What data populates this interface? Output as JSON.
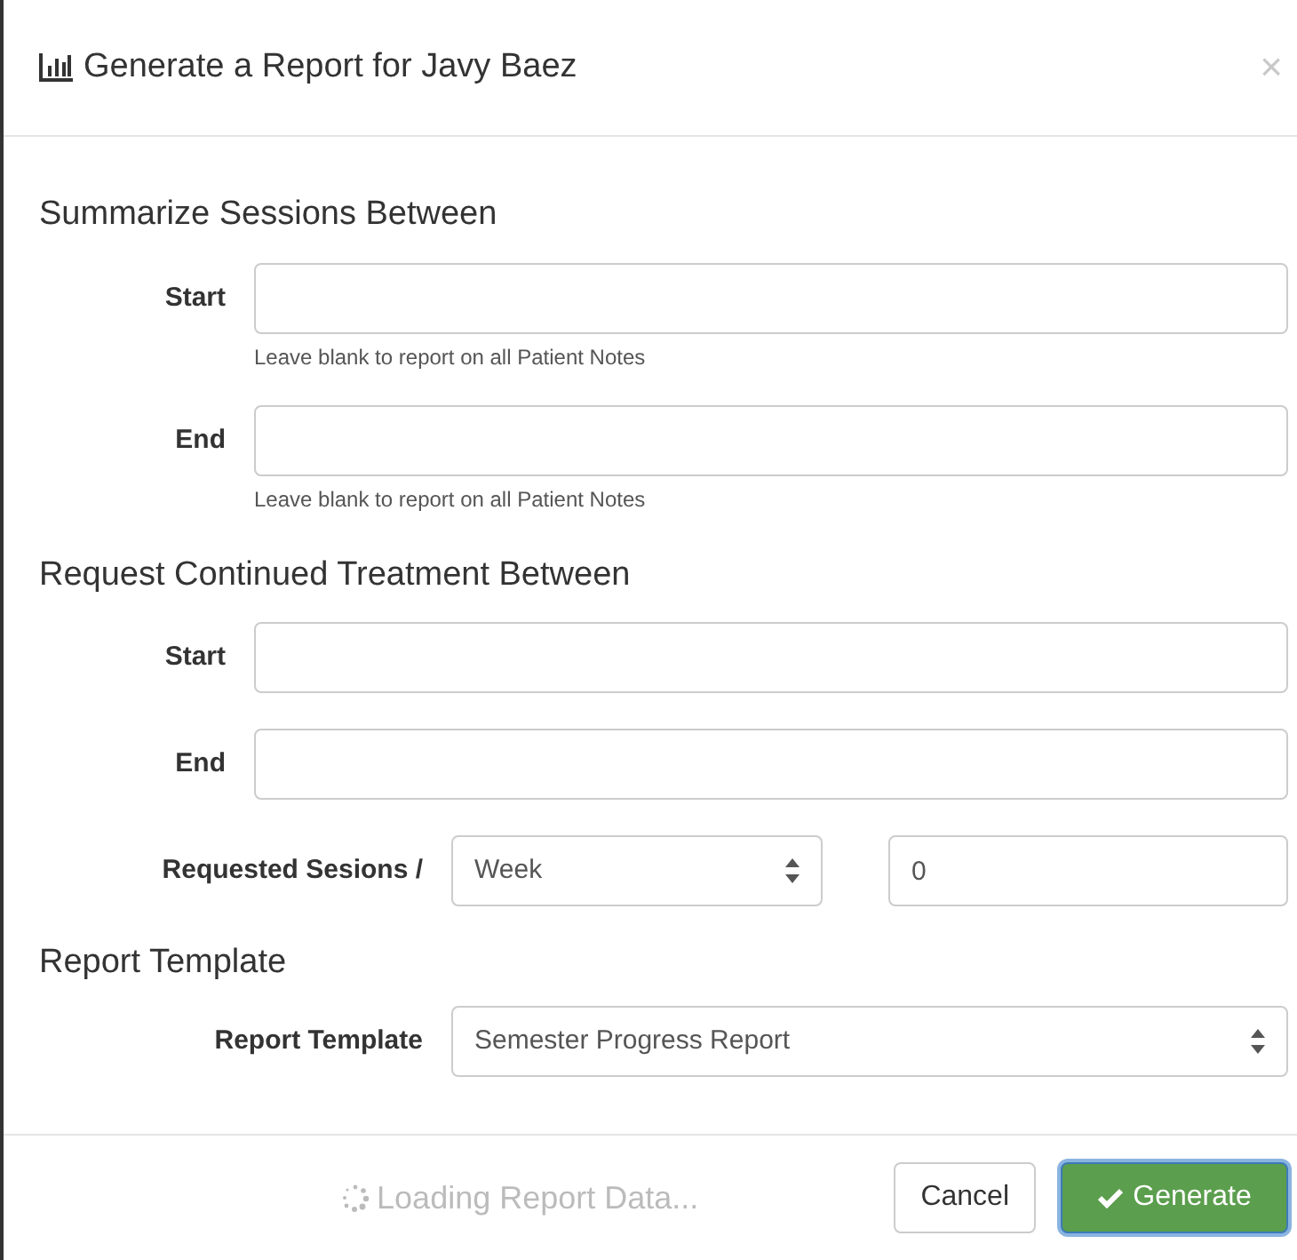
{
  "dialog": {
    "title": "Generate a Report for Javy Baez",
    "close": "×"
  },
  "summarize": {
    "heading": "Summarize Sessions Between",
    "fields": [
      {
        "label": "Start",
        "help": "Leave blank to report on all Patient Notes"
      },
      {
        "label": "End",
        "help": "Leave blank to report on all Patient Notes"
      }
    ]
  },
  "continued": {
    "heading": "Request Continued Treatment Between",
    "fields": [
      {
        "label": "Start"
      },
      {
        "label": "End"
      }
    ],
    "requested": {
      "label": "Requested Sesions /",
      "period": "Week",
      "count": "0"
    }
  },
  "template": {
    "heading": "Report Template",
    "label": "Report Template",
    "value": "Semester Progress Report"
  },
  "footer": {
    "loading": "Loading Report Data...",
    "cancel": "Cancel",
    "generate": "Generate"
  }
}
